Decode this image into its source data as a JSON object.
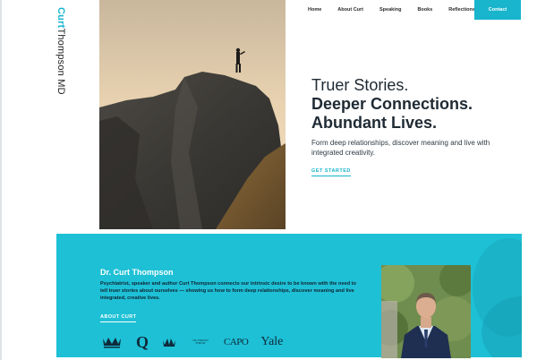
{
  "brand": {
    "first": "Curt",
    "rest": "Thompson MD"
  },
  "nav": {
    "items": [
      "Home",
      "About Curt",
      "Speaking",
      "Books",
      "Reflections"
    ],
    "contact": "Contact"
  },
  "hero": {
    "line1": "Truer Stories.",
    "line2": "Deeper Connections.",
    "line3": "Abundant Lives.",
    "subtitle": "Form deep relationships, discover meaning and live with integrated creativity.",
    "cta": "GET STARTED"
  },
  "about": {
    "title": "Dr. Curt Thompson",
    "text": "Psychiatrist, speaker and author Curt Thompson connects our intrinsic desire to be known with the need to tell truer stories about ourselves — showing us how to form deep relationships, discover meaning and live integrated, creative lives.",
    "link": "ABOUT CURT"
  },
  "logos": {
    "q": "Q",
    "veritas": "The VERITAS FORUM",
    "capo": "CAPO",
    "yale": "Yale"
  },
  "colors": {
    "accent": "#18b5cd",
    "band": "#1ec0d6",
    "text_dark": "#1f2a33"
  },
  "icons": [
    "crown-icon",
    "crown-icon"
  ]
}
